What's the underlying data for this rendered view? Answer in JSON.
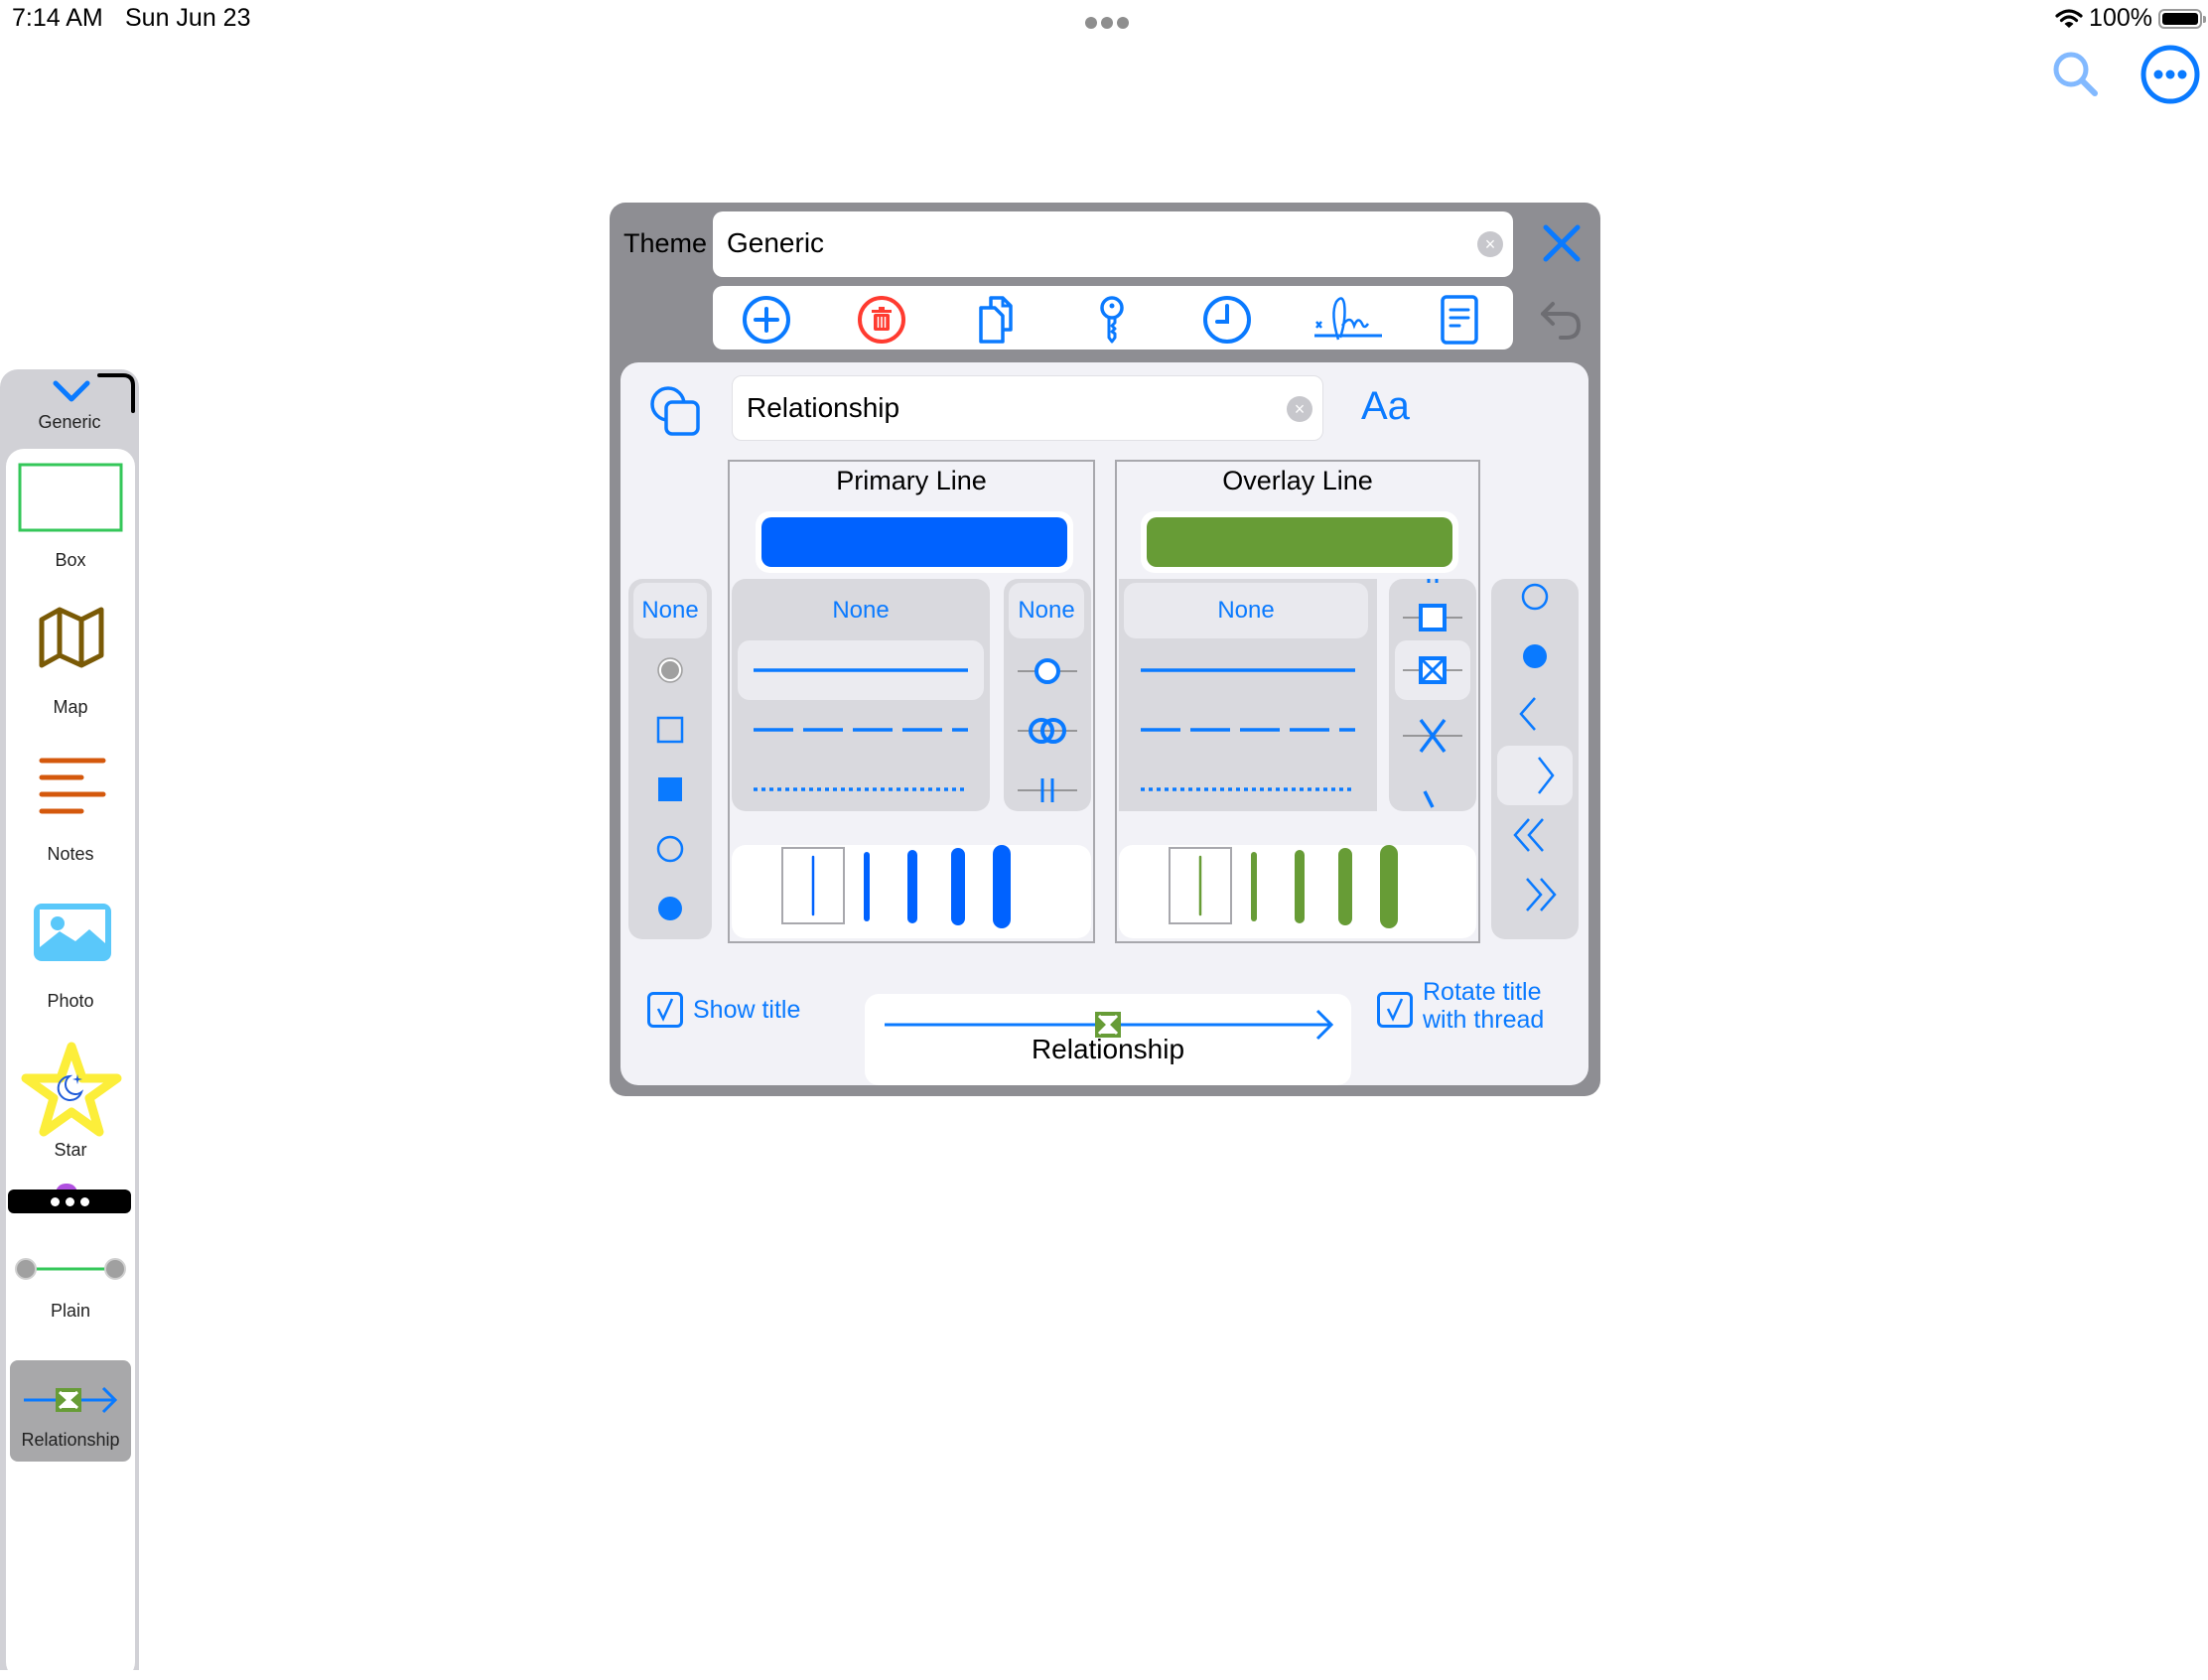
{
  "status_bar": {
    "time": "7:14 AM",
    "date": "Sun Jun 23",
    "battery_percent": "100%",
    "battery_level": 1.0
  },
  "top_actions": {
    "search_icon": "search-icon",
    "more_icon": "ellipsis-circle-icon"
  },
  "sidebar": {
    "theme_name": "Generic",
    "items": [
      {
        "label": "Box",
        "icon": "box-icon",
        "color": "#34c759"
      },
      {
        "label": "Map",
        "icon": "map-icon",
        "color": "#7a5a06"
      },
      {
        "label": "Notes",
        "icon": "notes-icon",
        "color": "#d4580c"
      },
      {
        "label": "Photo",
        "icon": "photo-icon",
        "color": "#5ac8fa"
      },
      {
        "label": "Star",
        "icon": "star-icon",
        "color": "#ffeb3b"
      },
      {
        "label": "",
        "icon": "more-menu-icon",
        "color": "#000000"
      },
      {
        "label": "Plain",
        "icon": "plain-line-icon",
        "color": "#34c759"
      },
      {
        "label": "Relationship",
        "icon": "relationship-line-icon",
        "color": "#0a7aff",
        "selected": true
      }
    ]
  },
  "theme_panel": {
    "theme_label": "Theme",
    "theme_value": "Generic",
    "toolbar": [
      {
        "name": "add",
        "icon": "plus-circle-icon",
        "color": "#0a7aff"
      },
      {
        "name": "delete",
        "icon": "trash-circle-icon",
        "color": "#ff3b30"
      },
      {
        "name": "duplicate",
        "icon": "duplicate-icon",
        "color": "#0a7aff"
      },
      {
        "name": "key",
        "icon": "key-icon",
        "color": "#0a7aff"
      },
      {
        "name": "history",
        "icon": "clock-icon",
        "color": "#0a7aff"
      },
      {
        "name": "signature",
        "icon": "signature-icon",
        "color": "#0a7aff"
      },
      {
        "name": "document",
        "icon": "document-icon",
        "color": "#0a7aff"
      }
    ],
    "style_name": "Relationship",
    "font_button": "Aa",
    "end_cap_column": {
      "none_label": "None",
      "options": [
        "gray-dot",
        "square-outline",
        "square-filled",
        "circle-outline",
        "circle-filled"
      ]
    },
    "primary_line": {
      "title": "Primary Line",
      "color": "#0062ff",
      "pattern_none": "None",
      "patterns": [
        "solid",
        "dashed",
        "dotted"
      ],
      "selected_pattern": "solid",
      "marker_none": "None",
      "markers": [
        "circle",
        "double-circle",
        "double-bar"
      ],
      "weights_count": 5,
      "selected_weight_index": 0
    },
    "overlay_line": {
      "title": "Overlay Line",
      "color": "#679c36",
      "pattern_none": "None",
      "patterns": [
        "solid",
        "dashed",
        "dotted"
      ],
      "markers": [
        "square",
        "crossed-square",
        "x-mark"
      ],
      "selected_marker": "crossed-square",
      "weights_count": 5,
      "selected_weight_index": 0
    },
    "arrow_column": {
      "options": [
        "circle-outline",
        "circle-filled",
        "chevron-left",
        "chevron-right",
        "double-chevron-left",
        "double-chevron-right"
      ],
      "selected": "chevron-right"
    },
    "show_title": {
      "label": "Show title",
      "checked": true
    },
    "preview_title": "Relationship",
    "rotate_title": {
      "label_line1": "Rotate title",
      "label_line2": "with thread",
      "checked": true
    }
  },
  "colors": {
    "accent": "#0a7aff",
    "panel_bg": "#8e8e93",
    "inner_bg": "#f2f2f7",
    "destructive": "#ff3b30"
  }
}
